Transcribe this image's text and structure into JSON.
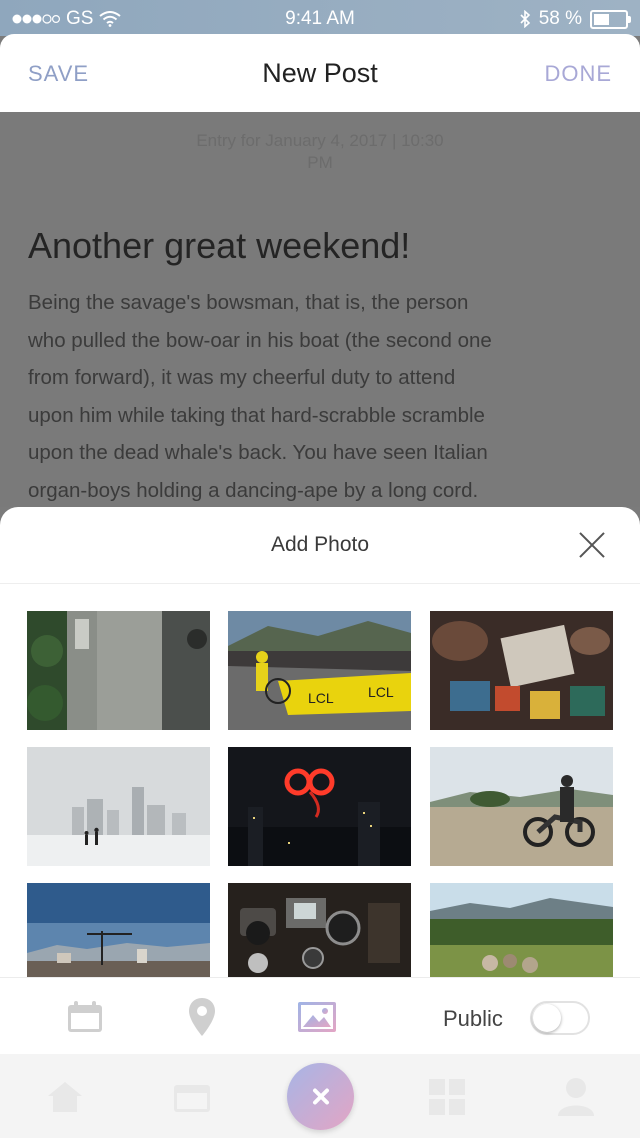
{
  "status_bar": {
    "carrier": "GS",
    "time": "9:41 AM",
    "battery": "58 %",
    "battery_level": 0.58
  },
  "nav": {
    "save_label": "SAVE",
    "title": "New Post",
    "done_label": "DONE"
  },
  "entry": {
    "date_line1": "Entry for January 4, 2017 | 10:30",
    "date_line2": "PM",
    "title": "Another great weekend!",
    "body_lines": [
      "Being the savage's bowsman, that is, the person",
      "who pulled the bow-oar in his boat (the second one",
      "from forward), it was my cheerful duty to attend",
      "upon him while taking that hard-scrabble scramble",
      "upon the dead whale's back. You have seen Italian",
      "organ-boys holding a dancing-ape by a long cord."
    ]
  },
  "add_photo": {
    "title": "Add Photo",
    "close_icon": "close-icon",
    "photos": [
      {
        "subject": "aerial-street"
      },
      {
        "subject": "cycling-race"
      },
      {
        "subject": "crafts-table"
      },
      {
        "subject": "snowy-city"
      },
      {
        "subject": "night-fireworks"
      },
      {
        "subject": "motorcycle-rider"
      },
      {
        "subject": "construction-skyline"
      },
      {
        "subject": "camera-gear"
      },
      {
        "subject": "green-valley"
      }
    ]
  },
  "toolbar": {
    "calendar_icon": "calendar-icon",
    "location_icon": "location-pin-icon",
    "photo_icon": "image-icon",
    "public_label": "Public",
    "public_enabled": false
  },
  "tab_bar": {
    "items": [
      "home-icon",
      "calendar-icon",
      "grid-icon",
      "profile-icon"
    ],
    "fab_icon": "close-icon"
  },
  "colors": {
    "accent_blue": "#8f9fc6",
    "accent_pink": "#e3a5c4",
    "status_bar": "#9eb2c4"
  }
}
